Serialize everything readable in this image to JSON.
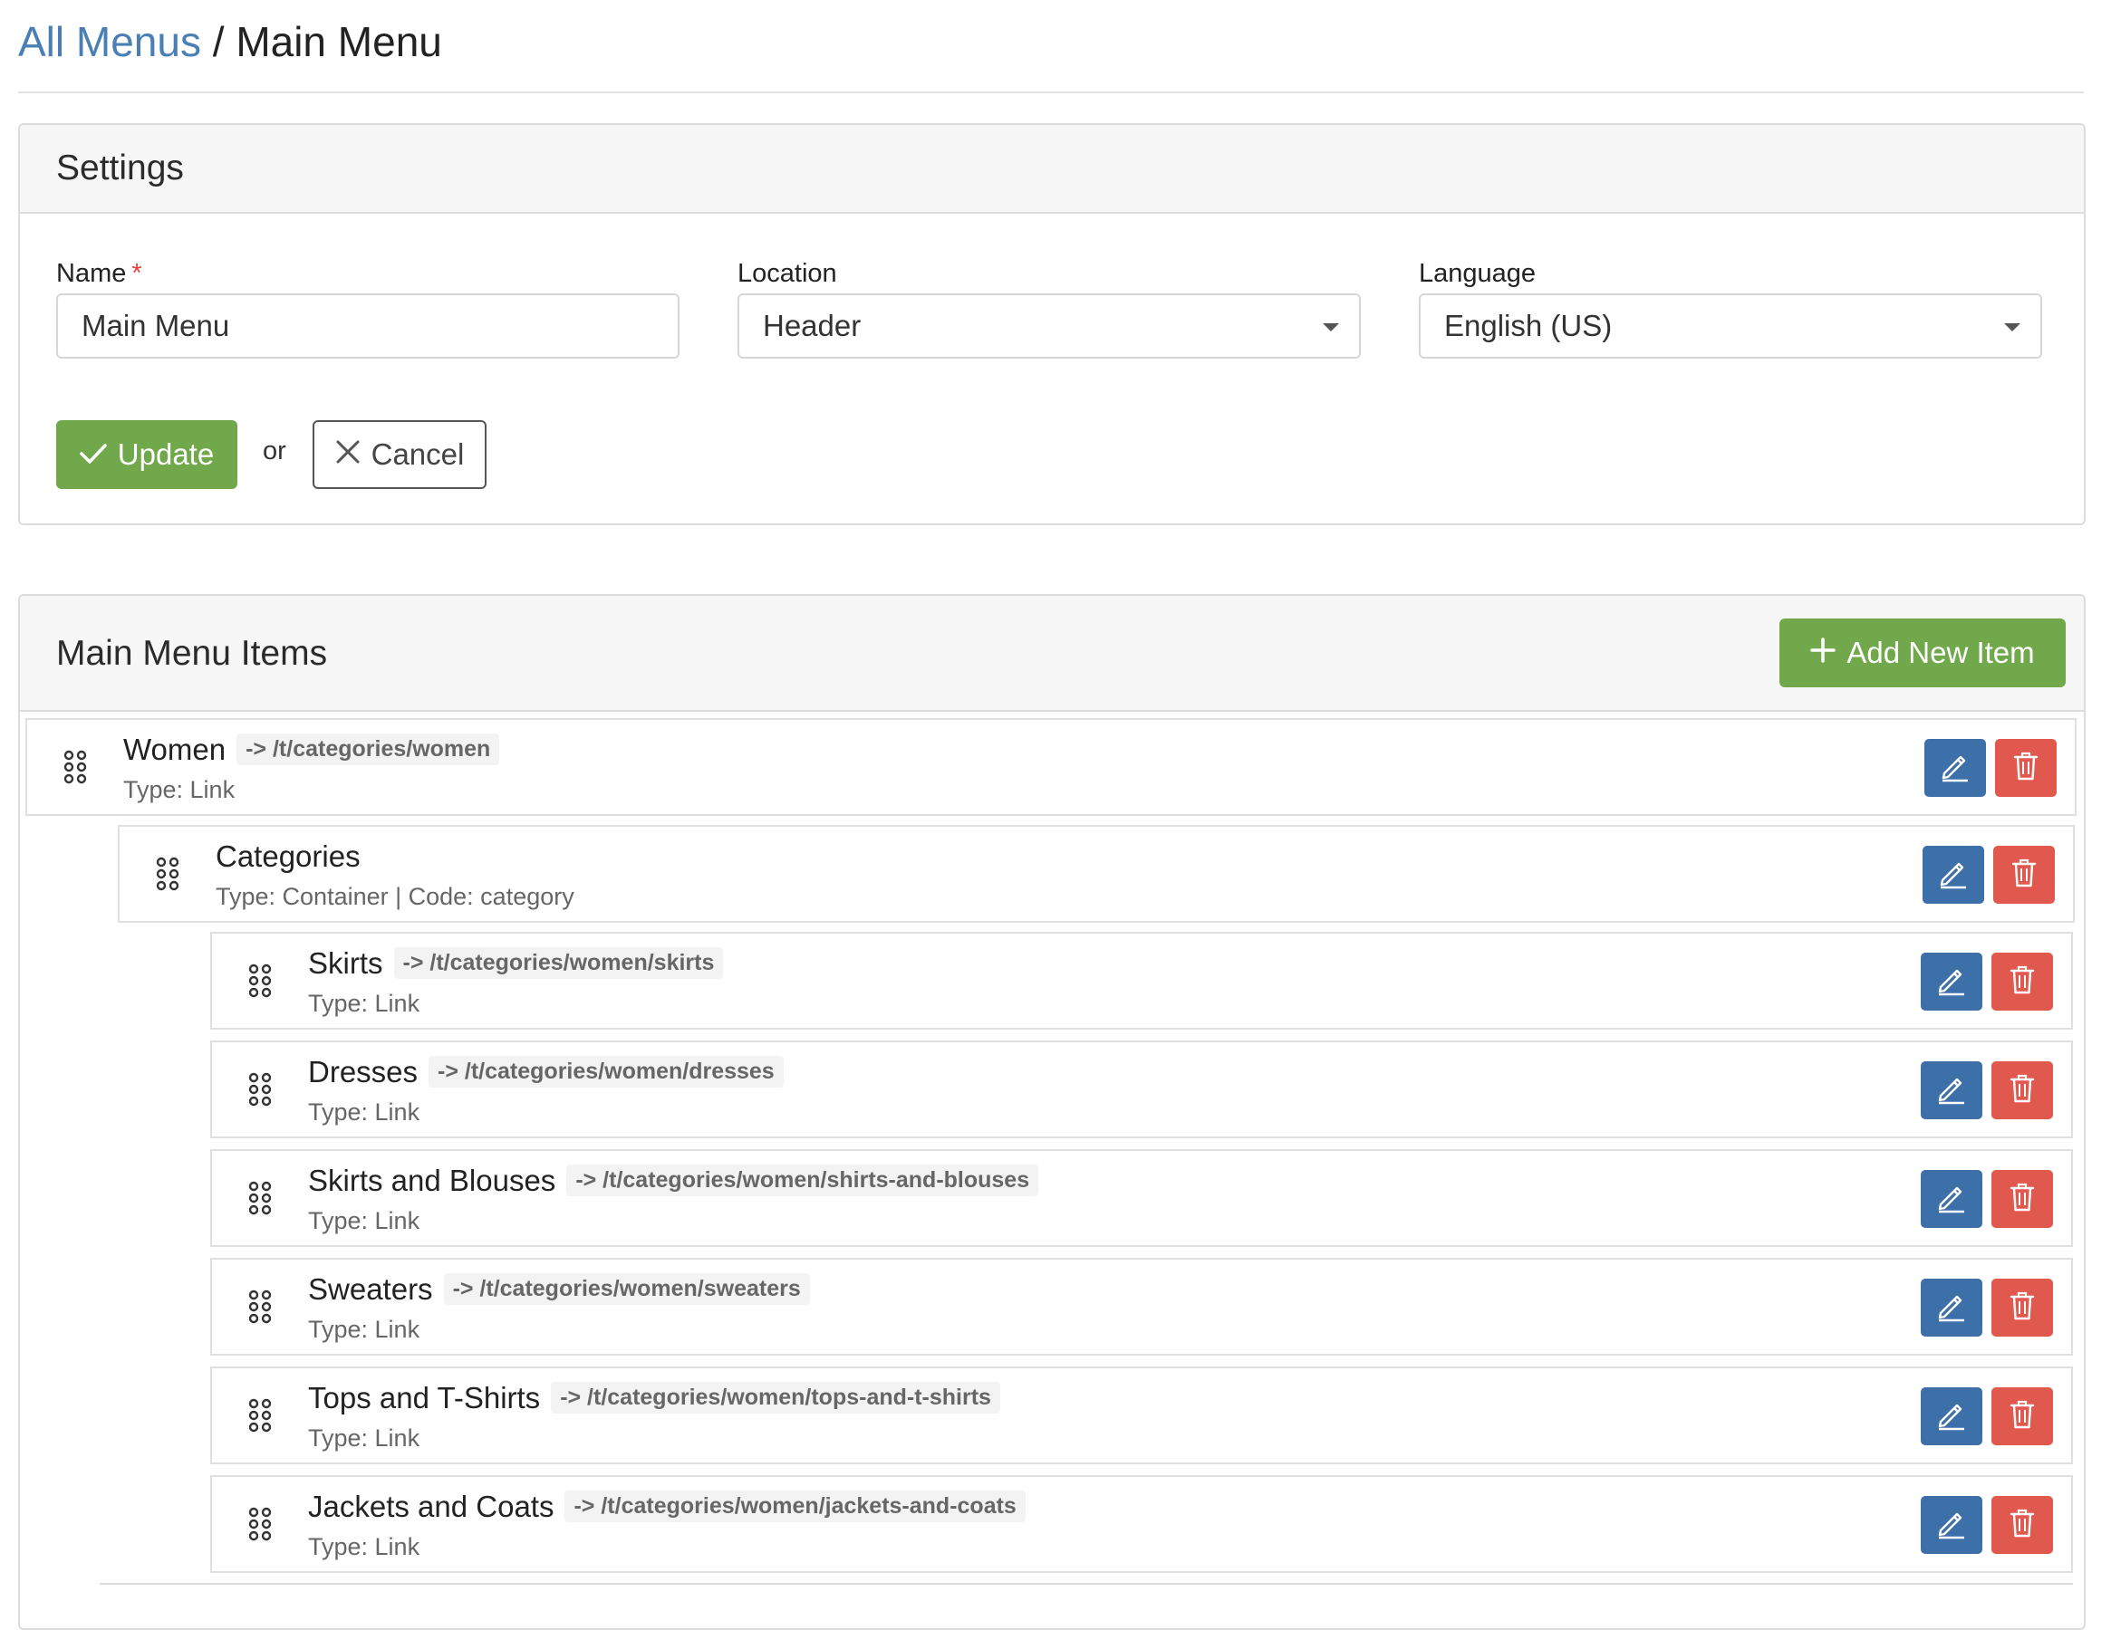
{
  "breadcrumb": {
    "parent": "All Menus",
    "separator": "/",
    "current": "Main Menu"
  },
  "settings": {
    "title": "Settings",
    "name_label": "Name",
    "required_marker": "*",
    "name_value": "Main Menu",
    "location_label": "Location",
    "location_value": "Header",
    "language_label": "Language",
    "language_value": "English (US)",
    "update_label": "Update",
    "or_text": "or",
    "cancel_label": "Cancel"
  },
  "menu_items": {
    "title": "Main Menu Items",
    "add_label": "Add New Item",
    "rows": [
      {
        "title": "Women",
        "path": "-> /t/categories/women",
        "sub": "Type: Link"
      },
      {
        "title": "Categories",
        "path": "",
        "sub": "Type: Container | Code: category"
      },
      {
        "title": "Skirts",
        "path": "-> /t/categories/women/skirts",
        "sub": "Type: Link"
      },
      {
        "title": "Dresses",
        "path": "-> /t/categories/women/dresses",
        "sub": "Type: Link"
      },
      {
        "title": "Skirts and Blouses",
        "path": "-> /t/categories/women/shirts-and-blouses",
        "sub": "Type: Link"
      },
      {
        "title": "Sweaters",
        "path": "-> /t/categories/women/sweaters",
        "sub": "Type: Link"
      },
      {
        "title": "Tops and T-Shirts",
        "path": "-> /t/categories/women/tops-and-t-shirts",
        "sub": "Type: Link"
      },
      {
        "title": "Jackets and Coats",
        "path": "-> /t/categories/women/jackets-and-coats",
        "sub": "Type: Link"
      }
    ]
  },
  "colors": {
    "link": "#4a7fb5",
    "success": "#70a84b",
    "edit": "#3d6fa8",
    "delete": "#e0584e",
    "required": "#e53e3e"
  },
  "icons": {
    "update": "check-icon",
    "cancel": "close-icon",
    "add": "plus-icon",
    "drag": "drag-handle-icon",
    "edit": "pencil-icon",
    "delete": "trash-icon",
    "select": "caret-down-icon"
  }
}
